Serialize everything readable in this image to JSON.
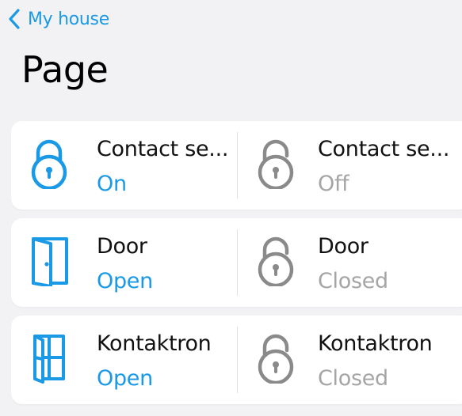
{
  "nav": {
    "back_label": "My house",
    "page_title": "Page"
  },
  "colors": {
    "accent": "#1a9ae6",
    "inactive": "#8a8a8a",
    "inactive_text": "#a5a5a5",
    "background": "#f2f2f4",
    "card": "#ffffff"
  },
  "rows": [
    {
      "left": {
        "name": "Contact se...",
        "state": "On",
        "icon": "lock-closed-icon",
        "active": true
      },
      "right": {
        "name": "Contact se...",
        "state": "Off",
        "icon": "lock-open-icon",
        "active": false
      }
    },
    {
      "left": {
        "name": "Door",
        "state": "Open",
        "icon": "door-open-icon",
        "active": true
      },
      "right": {
        "name": "Door",
        "state": "Closed",
        "icon": "lock-open-icon",
        "active": false
      }
    },
    {
      "left": {
        "name": "Kontaktron",
        "state": "Open",
        "icon": "window-open-icon",
        "active": true
      },
      "right": {
        "name": "Kontaktron",
        "state": "Closed",
        "icon": "lock-open-icon",
        "active": false
      }
    }
  ]
}
